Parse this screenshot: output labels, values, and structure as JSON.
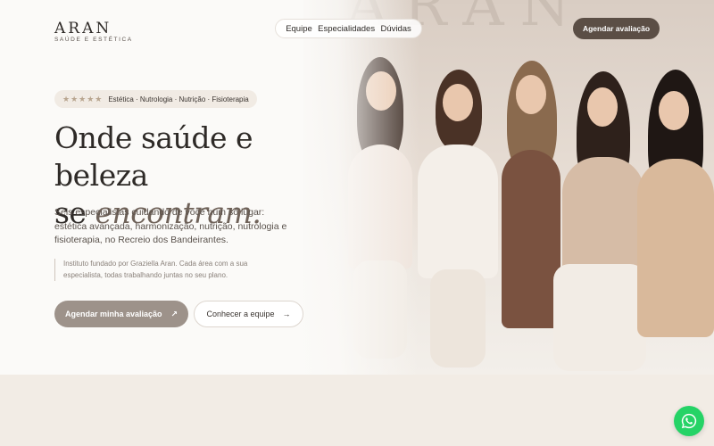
{
  "brand": {
    "name": "ARAN",
    "tagline": "SAÚDE E ESTÉTICA"
  },
  "nav": {
    "items": [
      "Equipe",
      "Especialidades",
      "Dúvidas"
    ]
  },
  "header_cta": {
    "label": "Agendar avaliação"
  },
  "badge": {
    "stars": "★★★★★",
    "text": "Estética · Nutrologia · Nutrição · Fisioterapia"
  },
  "headline": {
    "line1": "Onde saúde e beleza",
    "line2_prefix": "se ",
    "line2_emphasis": "encontram."
  },
  "description": "Seis especialistas cuidando de você num só lugar: estética avançada, harmonização, nutrição, nutrologia e fisioterapia, no Recreio dos Bandeirantes.",
  "note": "Instituto fundado por Graziella Aran. Cada área com a sua especialista, todas trabalhando juntas no seu plano.",
  "buttons": {
    "primary": {
      "label": "Agendar minha avaliação",
      "icon": "↗"
    },
    "secondary": {
      "label": "Conhecer a equipe",
      "icon": "→"
    }
  },
  "photo": {
    "wall_text": "ARAN"
  },
  "floating": {
    "icon": "whatsapp-icon"
  },
  "colors": {
    "accent_dark": "#5b4e45",
    "accent_muted": "#9d928a",
    "whatsapp": "#25d366"
  }
}
